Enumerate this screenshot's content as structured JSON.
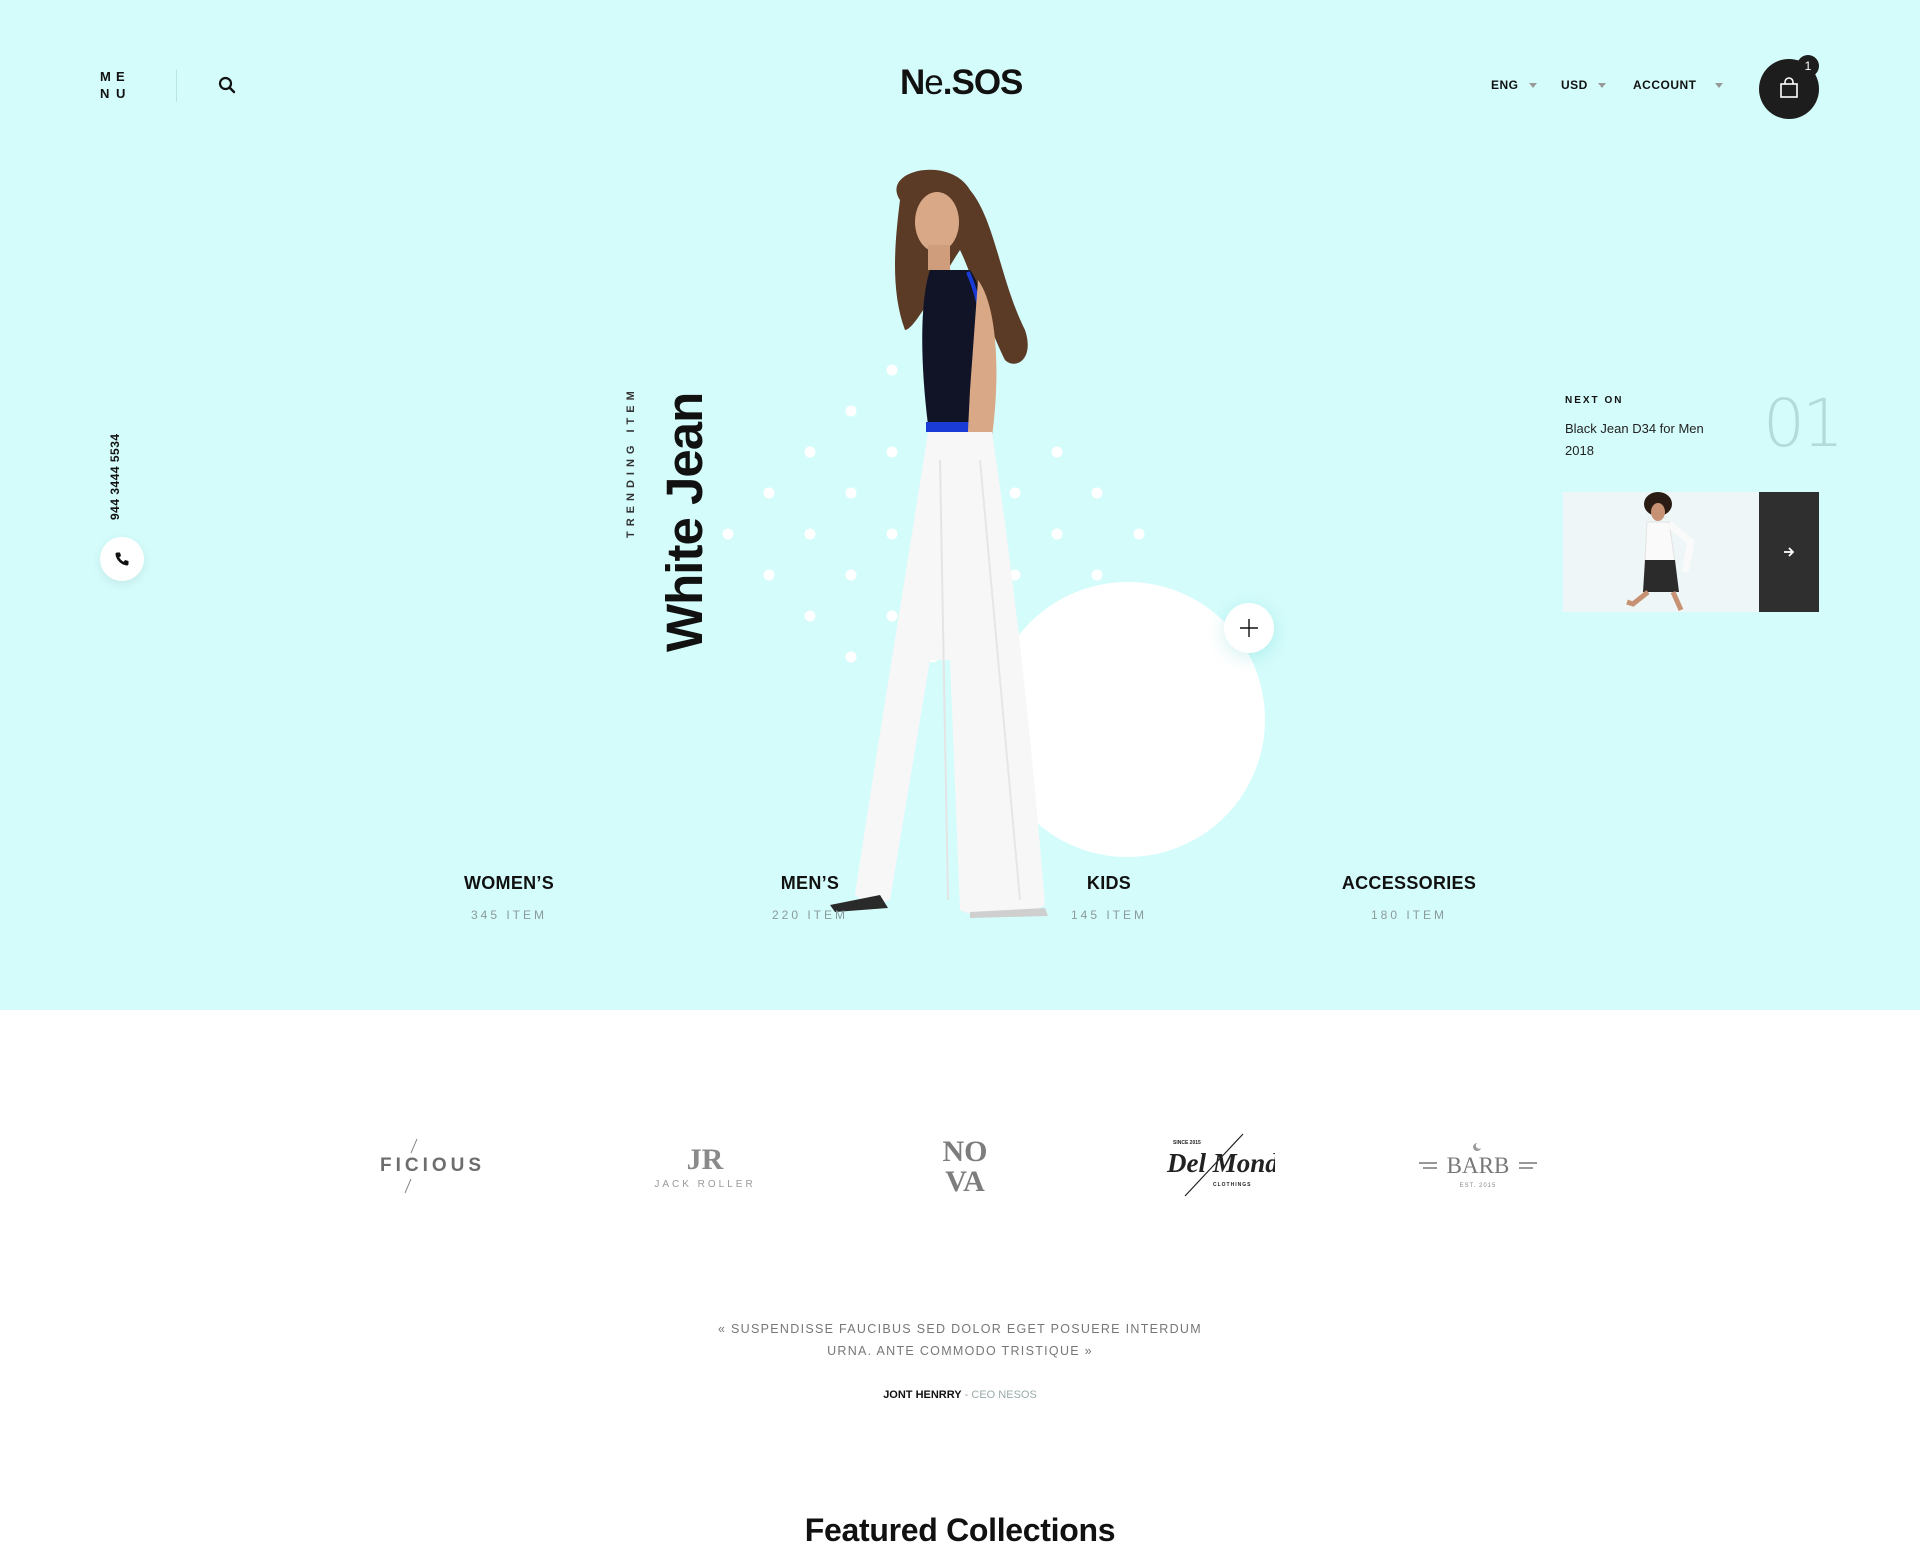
{
  "header": {
    "menu_letters": [
      "M",
      "E",
      "N",
      "U"
    ],
    "logo_main": "N",
    "logo_e": "e",
    "logo_rest": ".SOS",
    "language": "ENG",
    "currency": "USD",
    "account": "ACCOUNT",
    "cart_count": "1"
  },
  "contact": {
    "phone": "944 3444 5534"
  },
  "hero": {
    "trending_label": "TRENDING ITEM",
    "trending_title": "White Jean"
  },
  "categories": [
    {
      "name": "WOMEN’S",
      "count": "345 ITEM"
    },
    {
      "name": "MEN’S",
      "count": "220 ITEM"
    },
    {
      "name": "KIDS",
      "count": "145 ITEM"
    },
    {
      "name": "ACCESSORIES",
      "count": "180 ITEM"
    }
  ],
  "next_on": {
    "label": "NEXT ON",
    "title": "Black Jean D34 for Men 2018",
    "number": "01"
  },
  "brands": [
    {
      "name": "FICIOUS"
    },
    {
      "name": "JR",
      "sub": "JACK ROLLER"
    },
    {
      "name": "NOVA",
      "top": "NO",
      "bottom": "VA"
    },
    {
      "name": "Del Mondo",
      "top_small": "SINCE 2015",
      "sub": "CLOTHINGS"
    },
    {
      "name": "BARB",
      "sub": "EST. 2015"
    }
  ],
  "testimonial": {
    "quote": "« SUSPENDISSE FAUCIBUS SED DOLOR EGET POSUERE INTERDUM URNA. ANTE COMMODO TRISTIQUE »",
    "author": "JONT HENRRY",
    "separator": " - ",
    "role": "CEO NESOS"
  },
  "featured": {
    "title": "Featured Collections"
  },
  "colors": {
    "hero_bg": "#d4fcfb",
    "dark": "#1d1d1d",
    "muted": "#8a9a9a"
  }
}
